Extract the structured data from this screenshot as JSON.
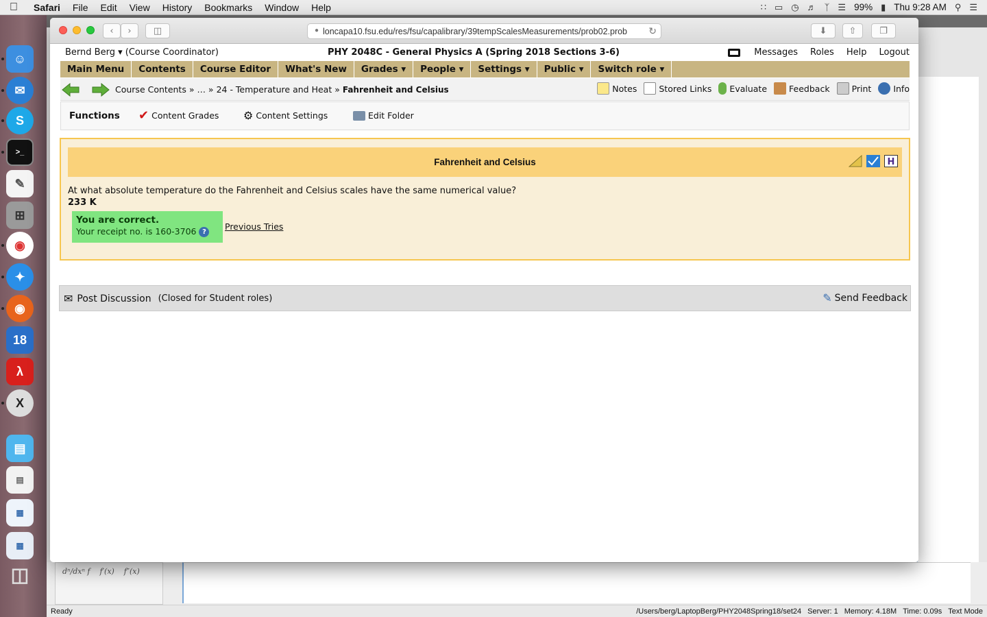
{
  "menubar": {
    "app": "Safari",
    "items": [
      "File",
      "Edit",
      "View",
      "History",
      "Bookmarks",
      "Window",
      "Help"
    ],
    "battery": "99%",
    "clock": "Thu 9:28 AM"
  },
  "browser": {
    "url": "loncapa10.fsu.edu/res/fsu/capalibrary/39tempScalesMeasurements/prob02.prob"
  },
  "header": {
    "user": "Bernd Berg ▾",
    "role": "(Course Coordinator)",
    "course": "PHY 2048C - General Physics A (Spring 2018 Sections 3-6)",
    "links": [
      "Messages",
      "Roles",
      "Help",
      "Logout"
    ]
  },
  "mainmenu": [
    "Main Menu",
    "Contents",
    "Course Editor",
    "What's New",
    "Grades ▾",
    "People ▾",
    "Settings ▾",
    "Public ▾",
    "Switch role ▾"
  ],
  "breadcrumb": {
    "part1": "Course Contents »",
    "part2": "… »",
    "part3": "24 - Temperature and Heat »",
    "current": "Fahrenheit and Celsius"
  },
  "tools": [
    "Notes",
    "Stored Links",
    "Evaluate",
    "Feedback",
    "Print",
    "Info"
  ],
  "functions": {
    "title": "Functions",
    "items": [
      "Content Grades",
      "Content Settings",
      "Edit Folder"
    ]
  },
  "problem": {
    "title": "Fahrenheit and Celsius",
    "question": "At what absolute temperature do the Fahrenheit and Celsius scales have the same numerical value?",
    "answer": "233 K",
    "correct_title": "You are correct.",
    "receipt": "Your receipt no. is 160-3706",
    "previous_tries": "Previous Tries"
  },
  "discussion": {
    "post": "Post Discussion",
    "closed": "(Closed for Student roles)",
    "send_feedback": "Send Feedback"
  },
  "statusbar": {
    "left": "Ready",
    "path": "/Users/berg/LaptopBerg/PHY2048Spring18/set24",
    "server": "Server: 1",
    "memory": "Memory: 4.18M",
    "time": "Time: 0.09s",
    "mode": "Text Mode"
  },
  "dock": {
    "badge": "18"
  },
  "colors": {
    "menu_tan": "#c8b582",
    "problem_header": "#fad27a",
    "problem_bg": "#f9efd8",
    "correct_green": "#80e580"
  }
}
